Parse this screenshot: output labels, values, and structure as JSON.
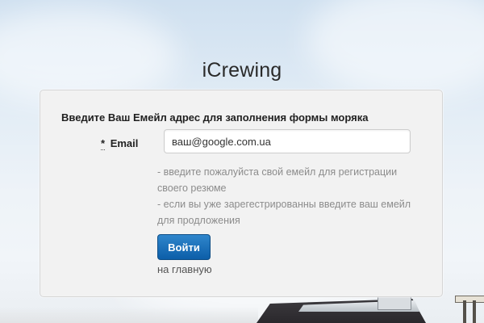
{
  "brand": {
    "title": "iCrewing"
  },
  "form": {
    "heading": "Введите Ваш Емейл адрес для заполнения формы моряка",
    "email": {
      "required_marker": "*",
      "label": "Email",
      "value": "ваш@google.com.ua"
    },
    "hints": [
      "- введите пожалуйста свой емейл для регистрации своего резюме",
      "- если вы уже зарегестрированны введите ваш емейл для продложения"
    ],
    "submit_label": "Войти",
    "home_link_label": "на главную"
  },
  "colors": {
    "button": "#1a6fb8",
    "panel_bg": "#f2f2f2",
    "hint_text": "#8c8c8c"
  }
}
